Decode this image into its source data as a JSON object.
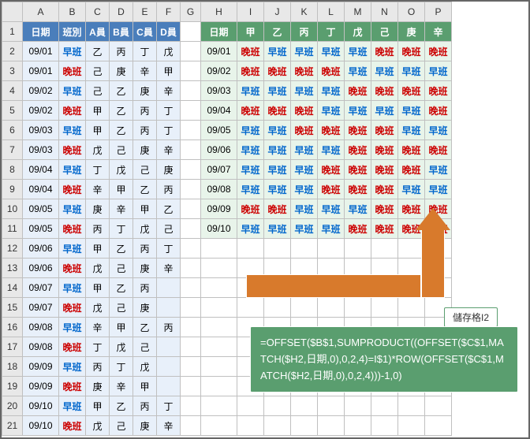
{
  "colHeaders": [
    "A",
    "B",
    "C",
    "D",
    "E",
    "F",
    "G",
    "H",
    "I",
    "J",
    "K",
    "L",
    "M",
    "N",
    "O",
    "P"
  ],
  "rowCount": 21,
  "left": {
    "headers": [
      "日期",
      "班別",
      "A員",
      "B員",
      "C員",
      "D員"
    ],
    "rows": [
      [
        "09/01",
        "早班",
        "乙",
        "丙",
        "丁",
        "戊"
      ],
      [
        "09/01",
        "晚班",
        "己",
        "庚",
        "辛",
        "甲"
      ],
      [
        "09/02",
        "早班",
        "己",
        "乙",
        "庚",
        "辛"
      ],
      [
        "09/02",
        "晚班",
        "甲",
        "乙",
        "丙",
        "丁"
      ],
      [
        "09/03",
        "早班",
        "甲",
        "乙",
        "丙",
        "丁"
      ],
      [
        "09/03",
        "晚班",
        "戊",
        "己",
        "庚",
        "辛"
      ],
      [
        "09/04",
        "早班",
        "丁",
        "戊",
        "己",
        "庚"
      ],
      [
        "09/04",
        "晚班",
        "辛",
        "甲",
        "乙",
        "丙"
      ],
      [
        "09/05",
        "早班",
        "庚",
        "辛",
        "甲",
        "乙"
      ],
      [
        "09/05",
        "晚班",
        "丙",
        "丁",
        "戊",
        "己"
      ],
      [
        "09/06",
        "早班",
        "甲",
        "乙",
        "丙",
        "丁"
      ],
      [
        "09/06",
        "晚班",
        "戊",
        "己",
        "庚",
        "辛"
      ],
      [
        "09/07",
        "早班",
        "甲",
        "乙",
        "丙",
        ""
      ],
      [
        "09/07",
        "晚班",
        "戊",
        "己",
        "庚",
        ""
      ],
      [
        "09/08",
        "早班",
        "辛",
        "甲",
        "乙",
        "丙"
      ],
      [
        "09/08",
        "晚班",
        "丁",
        "戊",
        "己",
        ""
      ],
      [
        "09/09",
        "早班",
        "丙",
        "丁",
        "戊",
        ""
      ],
      [
        "09/09",
        "晚班",
        "庚",
        "辛",
        "甲",
        ""
      ],
      [
        "09/10",
        "早班",
        "甲",
        "乙",
        "丙",
        "丁"
      ],
      [
        "09/10",
        "晚班",
        "戊",
        "己",
        "庚",
        "辛"
      ]
    ]
  },
  "right": {
    "headers": [
      "日期",
      "甲",
      "乙",
      "丙",
      "丁",
      "戊",
      "己",
      "庚",
      "辛"
    ],
    "rows": [
      [
        "09/01",
        "晚班",
        "早班",
        "早班",
        "早班",
        "早班",
        "晚班",
        "晚班",
        "晚班"
      ],
      [
        "09/02",
        "晚班",
        "晚班",
        "晚班",
        "晚班",
        "早班",
        "早班",
        "早班",
        "早班"
      ],
      [
        "09/03",
        "早班",
        "早班",
        "早班",
        "早班",
        "晚班",
        "晚班",
        "晚班",
        "晚班"
      ],
      [
        "09/04",
        "晚班",
        "晚班",
        "晚班",
        "早班",
        "早班",
        "早班",
        "早班",
        "晚班"
      ],
      [
        "09/05",
        "早班",
        "早班",
        "晚班",
        "晚班",
        "晚班",
        "晚班",
        "早班",
        "早班"
      ],
      [
        "09/06",
        "早班",
        "早班",
        "早班",
        "早班",
        "晚班",
        "晚班",
        "晚班",
        "晚班"
      ],
      [
        "09/07",
        "早班",
        "早班",
        "早班",
        "晚班",
        "晚班",
        "晚班",
        "晚班",
        "早班"
      ],
      [
        "09/08",
        "早班",
        "早班",
        "早班",
        "晚班",
        "晚班",
        "晚班",
        "早班",
        "早班"
      ],
      [
        "09/09",
        "晚班",
        "晚班",
        "早班",
        "早班",
        "早班",
        "晚班",
        "晚班",
        "晚班"
      ],
      [
        "09/10",
        "早班",
        "早班",
        "早班",
        "早班",
        "晚班",
        "晚班",
        "晚班",
        "晚班"
      ]
    ]
  },
  "formula": {
    "label": "儲存格I2",
    "text": "=OFFSET($B$1,SUMPRODUCT((OFFSET($C$1,MATCH($H2,日期,0),0,2,4)=I$1)*ROW(OFFSET($C$1,MATCH($H2,日期,0),0,2,4)))-1,0)"
  }
}
